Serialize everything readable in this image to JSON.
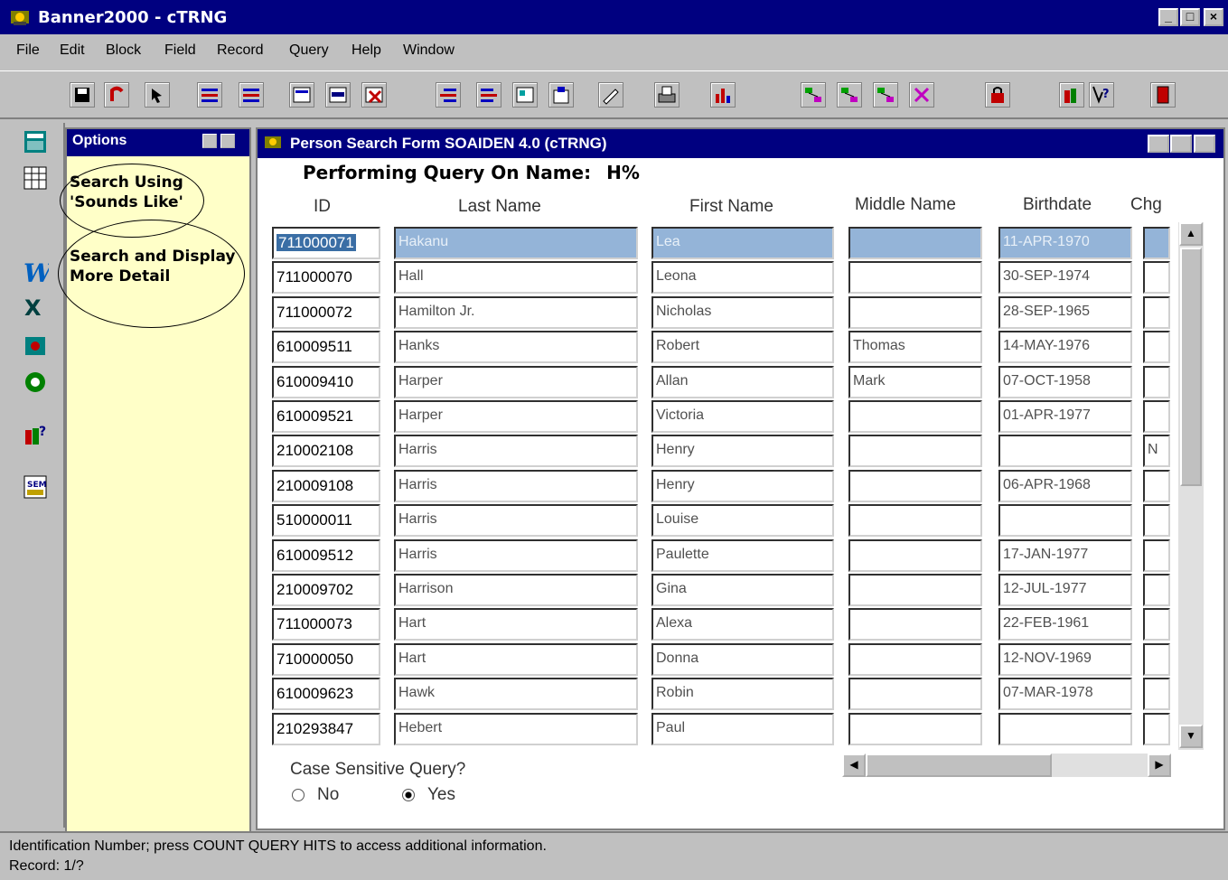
{
  "app": {
    "title": "Banner2000 - cTRNG"
  },
  "window_buttons": {
    "minimize": "_",
    "maximize": "□",
    "close": "×"
  },
  "menu": [
    "File",
    "Edit",
    "Block",
    "Field",
    "Record",
    "Query",
    "Help",
    "Window"
  ],
  "options": {
    "title": "Options",
    "items": [
      "Search Using 'Sounds Like'",
      "Search and Display More Detail"
    ]
  },
  "form": {
    "title": "Person Search Form  SOAIDEN  4.0  (cTRNG)",
    "query_label": "Performing Query On Name:",
    "query_value": "H%",
    "columns": [
      "ID",
      "Last Name",
      "First Name",
      "Middle Name",
      "Birthdate",
      "Chg"
    ],
    "rows": [
      {
        "id": "711000071",
        "last": "Hakanu",
        "first": "Lea",
        "middle": "",
        "birth": "11-APR-1970",
        "chg": ""
      },
      {
        "id": "711000070",
        "last": "Hall",
        "first": "Leona",
        "middle": "",
        "birth": "30-SEP-1974",
        "chg": ""
      },
      {
        "id": "711000072",
        "last": "Hamilton Jr.",
        "first": "Nicholas",
        "middle": "",
        "birth": "28-SEP-1965",
        "chg": ""
      },
      {
        "id": "610009511",
        "last": "Hanks",
        "first": "Robert",
        "middle": "Thomas",
        "birth": "14-MAY-1976",
        "chg": ""
      },
      {
        "id": "610009410",
        "last": "Harper",
        "first": "Allan",
        "middle": "Mark",
        "birth": "07-OCT-1958",
        "chg": ""
      },
      {
        "id": "610009521",
        "last": "Harper",
        "first": "Victoria",
        "middle": "",
        "birth": "01-APR-1977",
        "chg": ""
      },
      {
        "id": "210002108",
        "last": "Harris",
        "first": "Henry",
        "middle": "",
        "birth": "",
        "chg": "N"
      },
      {
        "id": "210009108",
        "last": "Harris",
        "first": "Henry",
        "middle": "",
        "birth": "06-APR-1968",
        "chg": ""
      },
      {
        "id": "510000011",
        "last": "Harris",
        "first": "Louise",
        "middle": "",
        "birth": "",
        "chg": ""
      },
      {
        "id": "610009512",
        "last": "Harris",
        "first": "Paulette",
        "middle": "",
        "birth": "17-JAN-1977",
        "chg": ""
      },
      {
        "id": "210009702",
        "last": "Harrison",
        "first": "Gina",
        "middle": "",
        "birth": "12-JUL-1977",
        "chg": ""
      },
      {
        "id": "711000073",
        "last": "Hart",
        "first": "Alexa",
        "middle": "",
        "birth": "22-FEB-1961",
        "chg": ""
      },
      {
        "id": "710000050",
        "last": "Hart",
        "first": "Donna",
        "middle": "",
        "birth": "12-NOV-1969",
        "chg": ""
      },
      {
        "id": "610009623",
        "last": "Hawk",
        "first": "Robin",
        "middle": "",
        "birth": "07-MAR-1978",
        "chg": ""
      },
      {
        "id": "210293847",
        "last": "Hebert",
        "first": "Paul",
        "middle": "",
        "birth": "",
        "chg": ""
      }
    ],
    "case_label": "Case Sensitive Query?",
    "radio_no": "No",
    "radio_yes": "Yes",
    "radio_selected": "Yes"
  },
  "status": {
    "hint": "Identification Number; press COUNT QUERY HITS to access additional information.",
    "record": "Record: 1/?"
  },
  "colors": {
    "titlebar": "#000080",
    "options_bg": "#ffffc8",
    "selected_row": "#94b4d8"
  }
}
